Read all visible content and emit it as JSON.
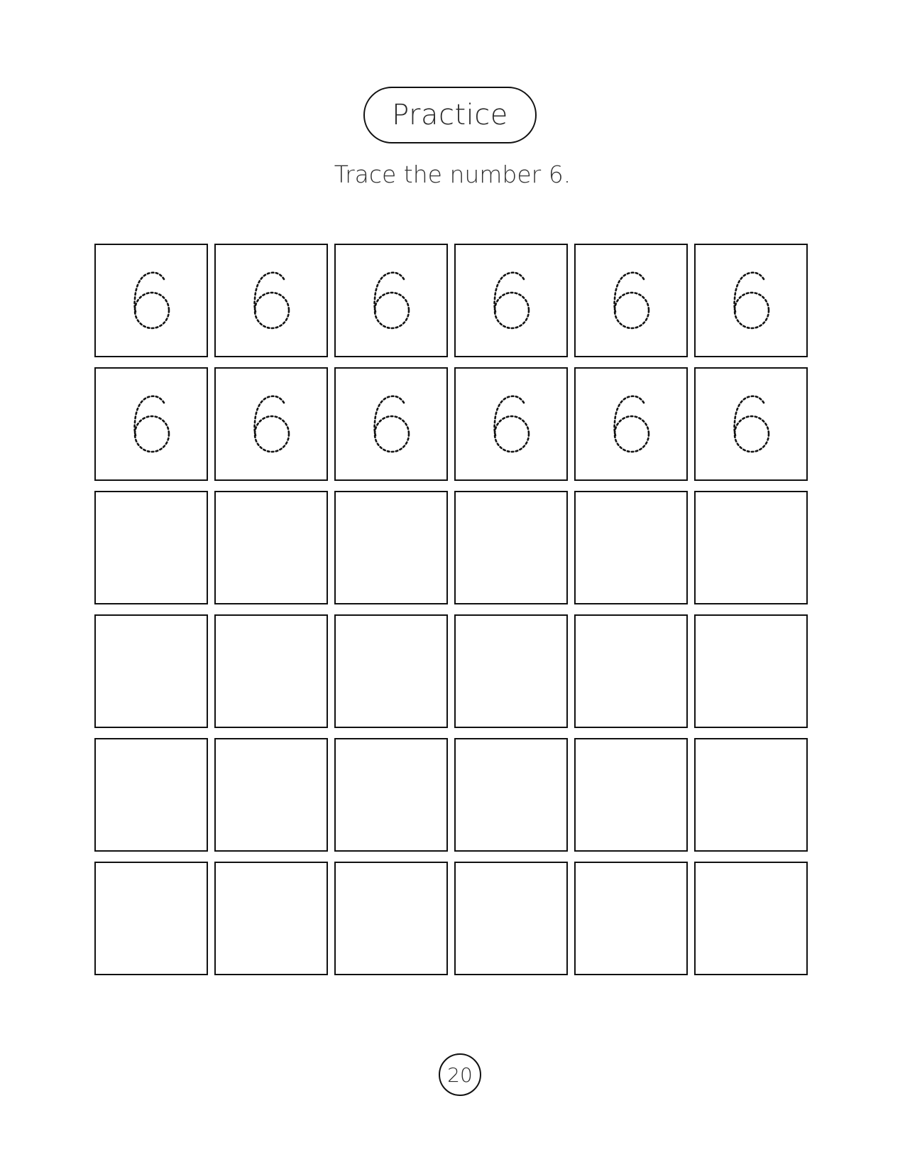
{
  "header": {
    "title": "Practice",
    "instruction": "Trace the number 6."
  },
  "worksheet": {
    "digit": "6",
    "columns": 6,
    "rows": 6,
    "traced_rows": 2
  },
  "footer": {
    "page_number": "20"
  }
}
